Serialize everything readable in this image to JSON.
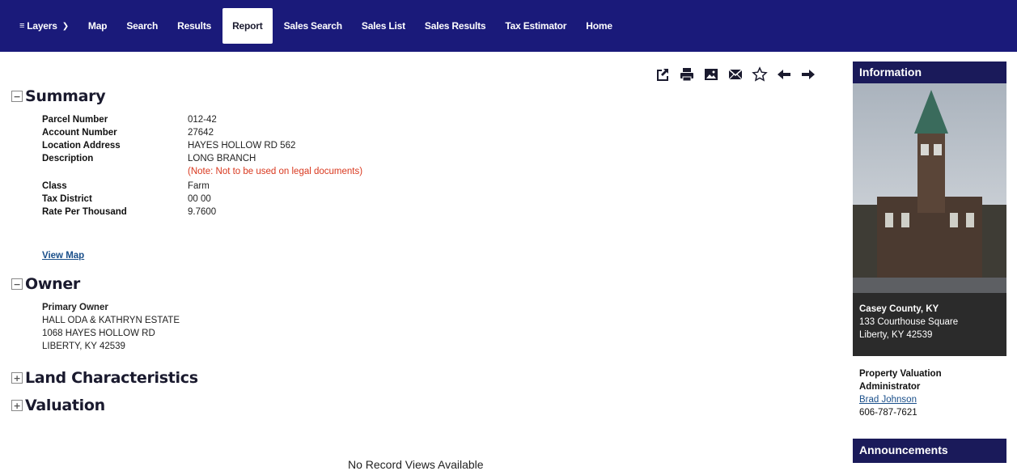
{
  "nav": {
    "items": [
      {
        "label": "Layers",
        "key": "layers"
      },
      {
        "label": "Map",
        "key": "map"
      },
      {
        "label": "Search",
        "key": "search"
      },
      {
        "label": "Results",
        "key": "results"
      },
      {
        "label": "Report",
        "key": "report",
        "active": true
      },
      {
        "label": "Sales Search",
        "key": "sales-search"
      },
      {
        "label": "Sales List",
        "key": "sales-list"
      },
      {
        "label": "Sales Results",
        "key": "sales-results"
      },
      {
        "label": "Tax Estimator",
        "key": "tax-estimator"
      },
      {
        "label": "Home",
        "key": "home"
      }
    ]
  },
  "toolbar": [
    "share-icon",
    "print-icon",
    "image-icon",
    "email-icon",
    "star-icon",
    "arrow-left-icon",
    "arrow-right-icon"
  ],
  "summary": {
    "title": "Summary",
    "parcel_label": "Parcel Number",
    "parcel_value": "012-42",
    "account_label": "Account Number",
    "account_value": "27642",
    "location_label": "Location Address",
    "location_value": "HAYES HOLLOW RD 562",
    "desc_label": "Description",
    "desc_value": "LONG BRANCH",
    "desc_note": "(Note: Not to be used on legal documents)",
    "class_label": "Class",
    "class_value": "Farm",
    "tax_label": "Tax District",
    "tax_value": "00 00",
    "rate_label": "Rate Per Thousand",
    "rate_value": "9.7600",
    "view_map": "View Map"
  },
  "owner": {
    "title": "Owner",
    "primary_label": "Primary Owner",
    "name": "HALL ODA & KATHRYN ESTATE",
    "street": "1068 HAYES HOLLOW RD",
    "city": "LIBERTY, KY 42539"
  },
  "land": {
    "title": "Land Characteristics"
  },
  "valuation": {
    "title": "Valuation"
  },
  "no_record": "No Record Views Available",
  "side": {
    "info_title": "Information",
    "county": "Casey County, KY",
    "address1": "133 Courthouse Square",
    "address2": "Liberty, KY 42539",
    "pva_line1": "Property Valuation",
    "pva_line2": "Administrator",
    "pva_name": "Brad Johnson",
    "pva_phone": "606-787-7621",
    "announcements_title": "Announcements"
  },
  "colors": {
    "nav_bg": "#1a1a7a",
    "panel_head": "#1a1a5a",
    "note": "#d9381e",
    "link": "#1a4f8a"
  }
}
